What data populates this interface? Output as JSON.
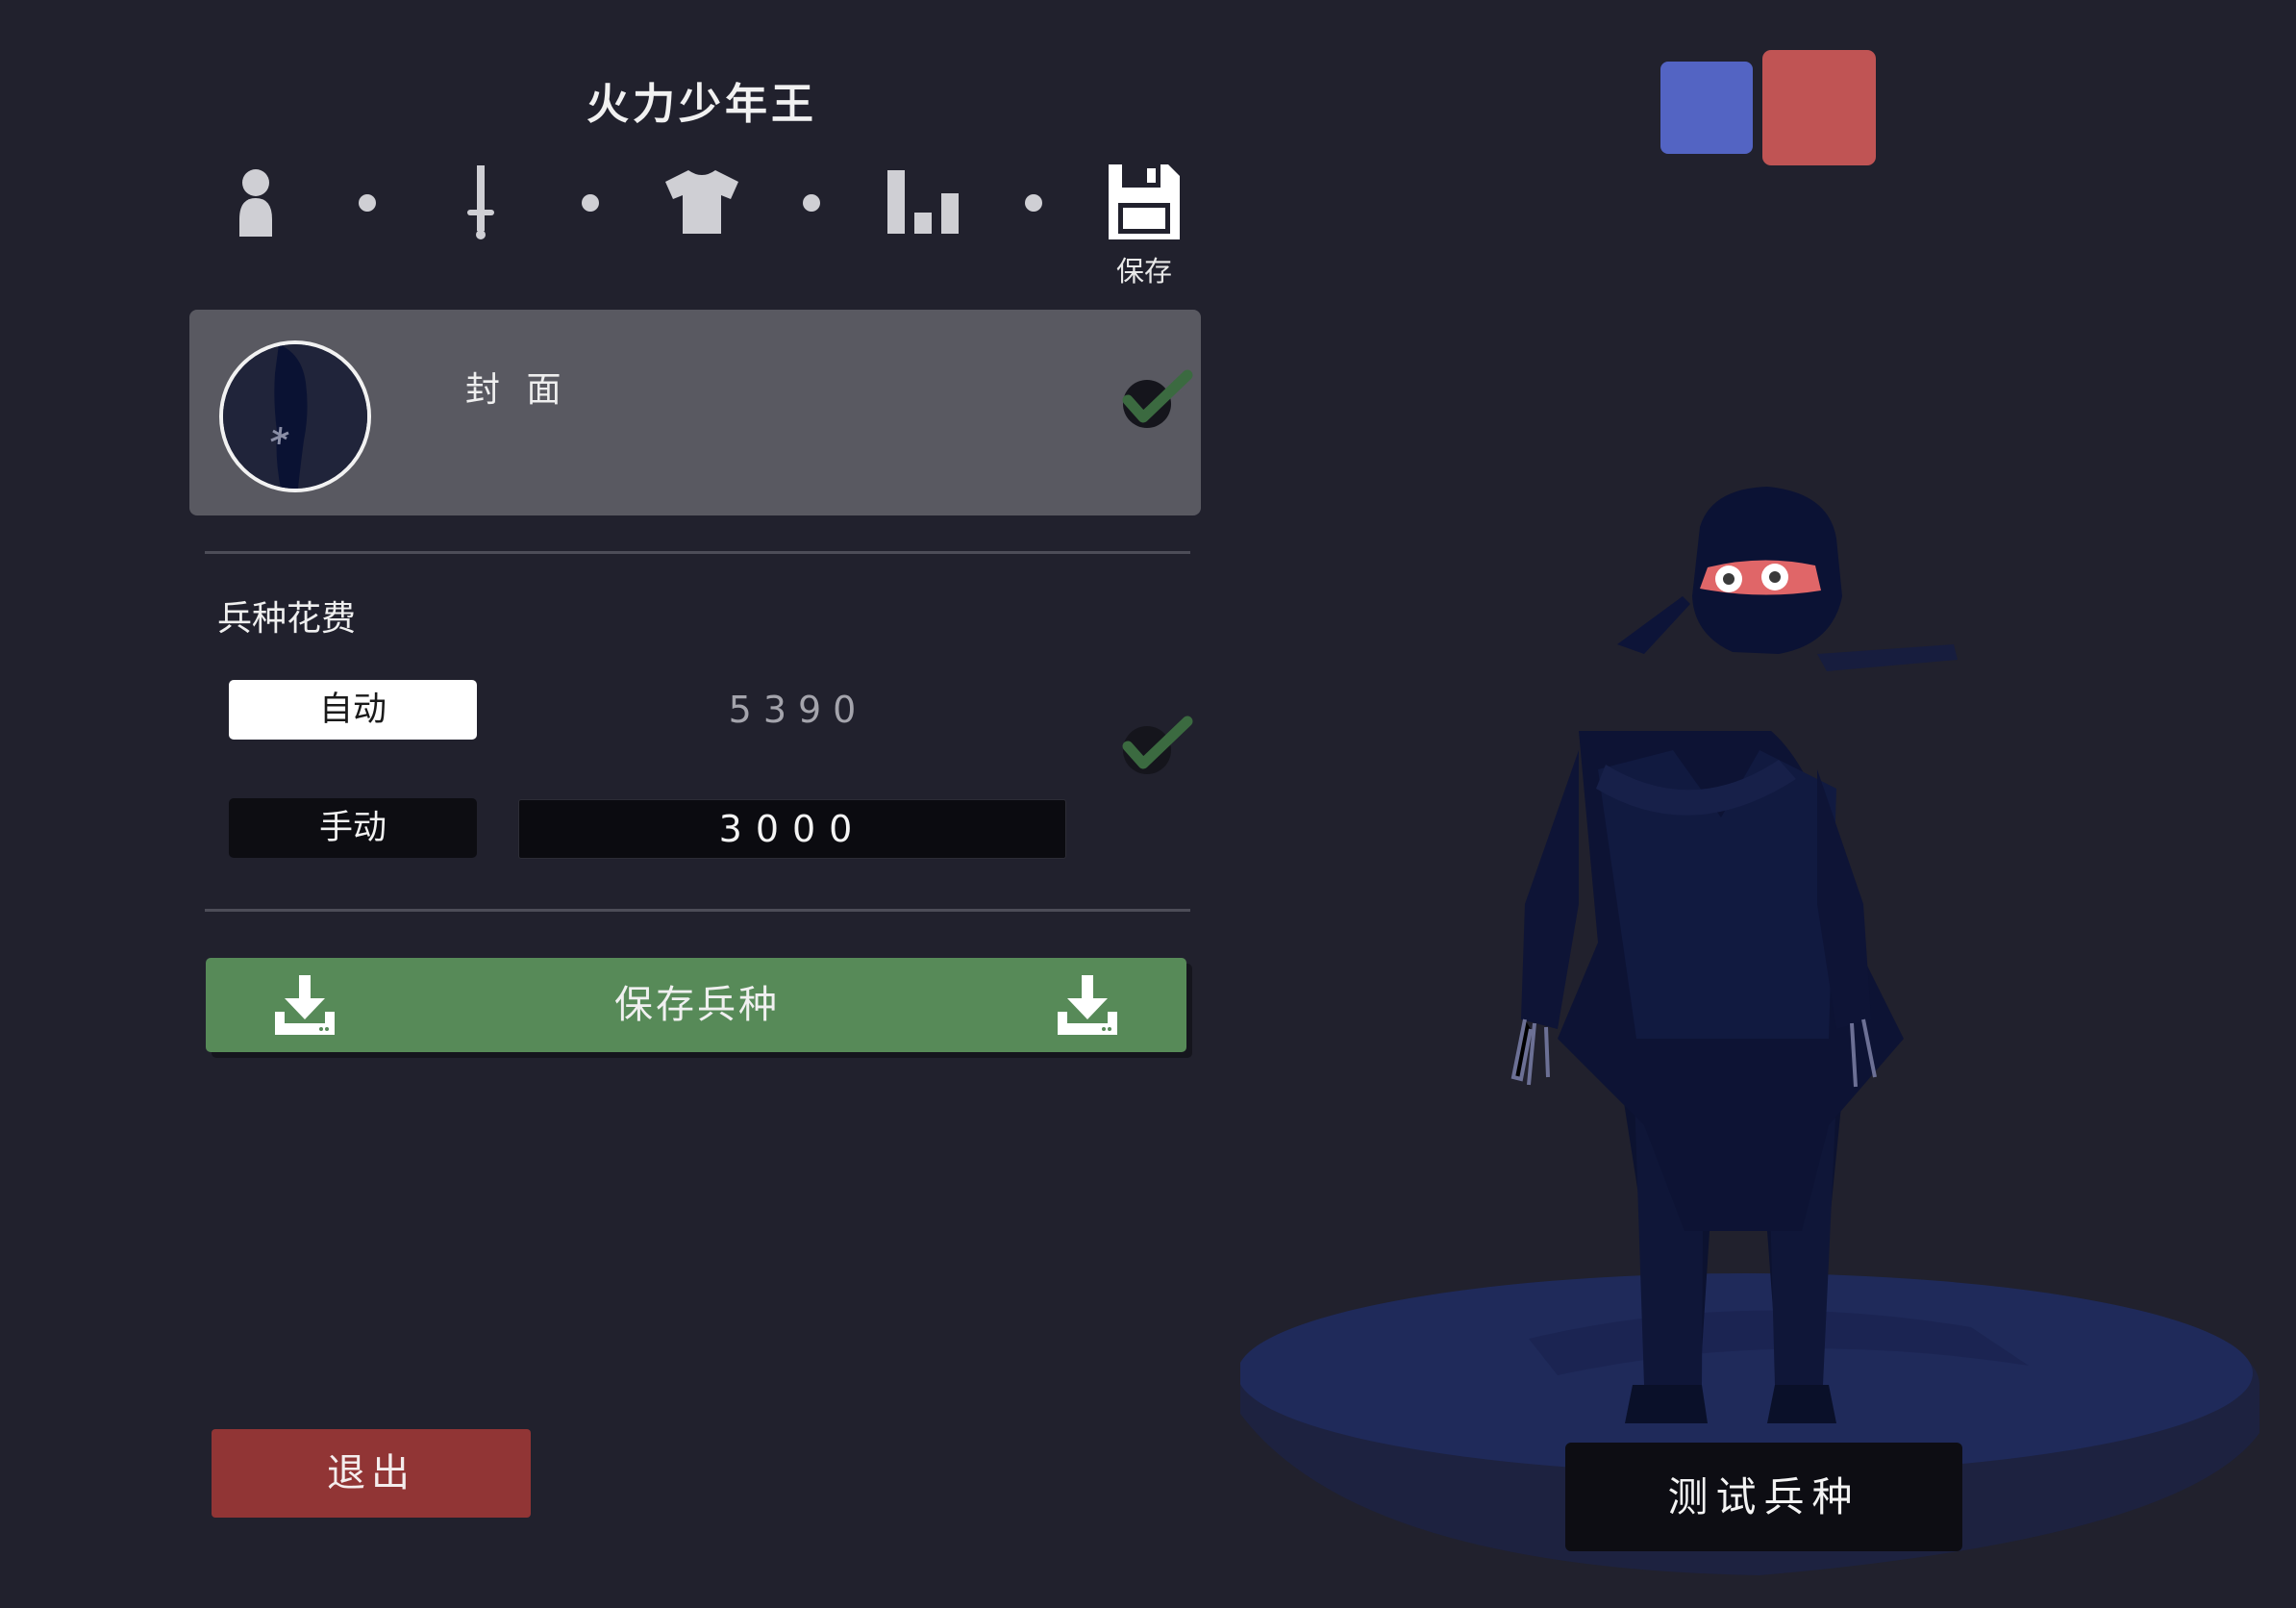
{
  "header": {
    "title": "火力少年王",
    "nav": [
      {
        "icon": "person-icon"
      },
      {
        "icon": "sword-icon"
      },
      {
        "icon": "shirt-icon"
      },
      {
        "icon": "stats-icon"
      },
      {
        "icon": "save-disk-icon",
        "label": "保存"
      }
    ]
  },
  "cover": {
    "label": "封 面",
    "selected": true
  },
  "cost": {
    "title": "兵种花费",
    "auto_label": "自动",
    "auto_value": "5390",
    "manual_label": "手动",
    "manual_value": "3000"
  },
  "save_unit": {
    "label": "保存兵种"
  },
  "exit": {
    "label": "退出"
  },
  "preview": {
    "test_label": "测试兵种"
  },
  "colors": {
    "background": "#21212d",
    "team_blue": "#5364c3",
    "team_red": "#c05454",
    "save_green": "#578a58",
    "exit_red": "#913535",
    "check_green": "#3b6a40"
  }
}
